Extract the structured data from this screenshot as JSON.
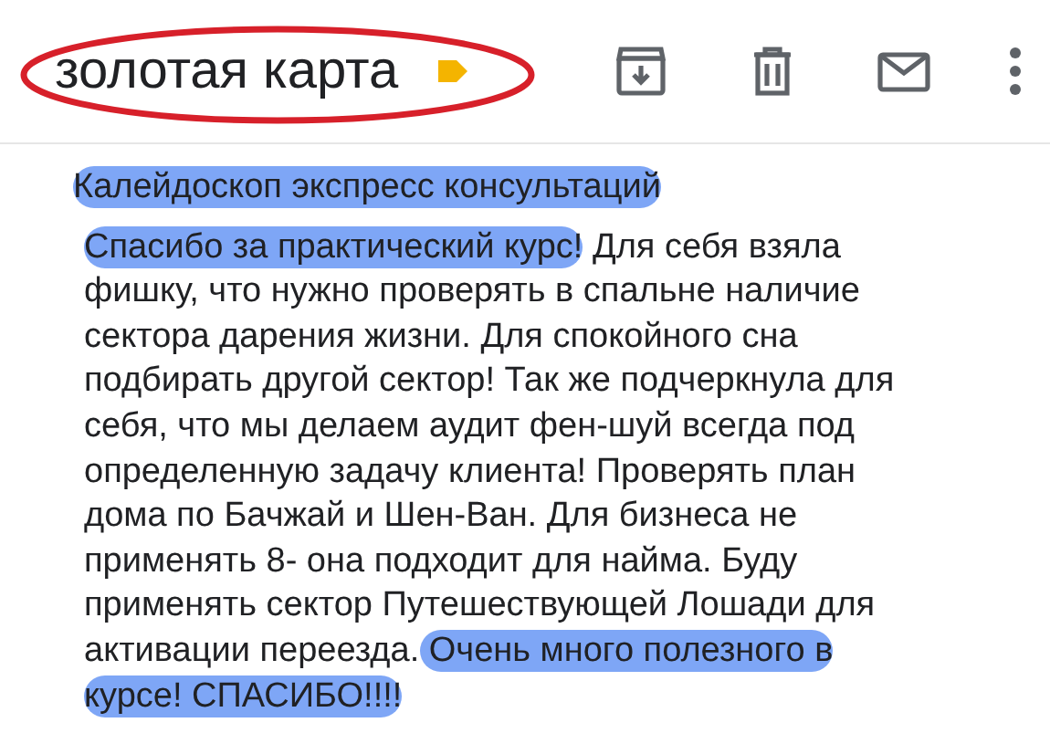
{
  "header": {
    "title": "золотая карта",
    "circled": true
  },
  "toolbar": [
    {
      "kind": "archive"
    },
    {
      "kind": "delete"
    },
    {
      "kind": "mail"
    },
    {
      "kind": "more"
    }
  ],
  "subject": {
    "text": "Калейдоскоп экспресс консультаций",
    "highlighted": true
  },
  "body": [
    {
      "text": "Спасибо за практический курс!",
      "highlighted": true
    },
    {
      "text": " Для себя взяла фишку, что нужно проверять в спальне наличие сектора дарения жизни. Для спокойного сна подбирать другой сектор! Так же подчеркнула для себя, что мы делаем аудит фен-шуй всегда под определенную задачу клиента! Проверять план дома по Бачжай и Шен-Ван. Для бизнеса не применять 8- она подходит для найма. Буду применять сектор Путешествующей Лошади для активации переезда.",
      "highlighted": false
    },
    {
      "text": " Очень много полезного в курсе! СПАСИБО!!!!",
      "highlighted": true
    }
  ]
}
